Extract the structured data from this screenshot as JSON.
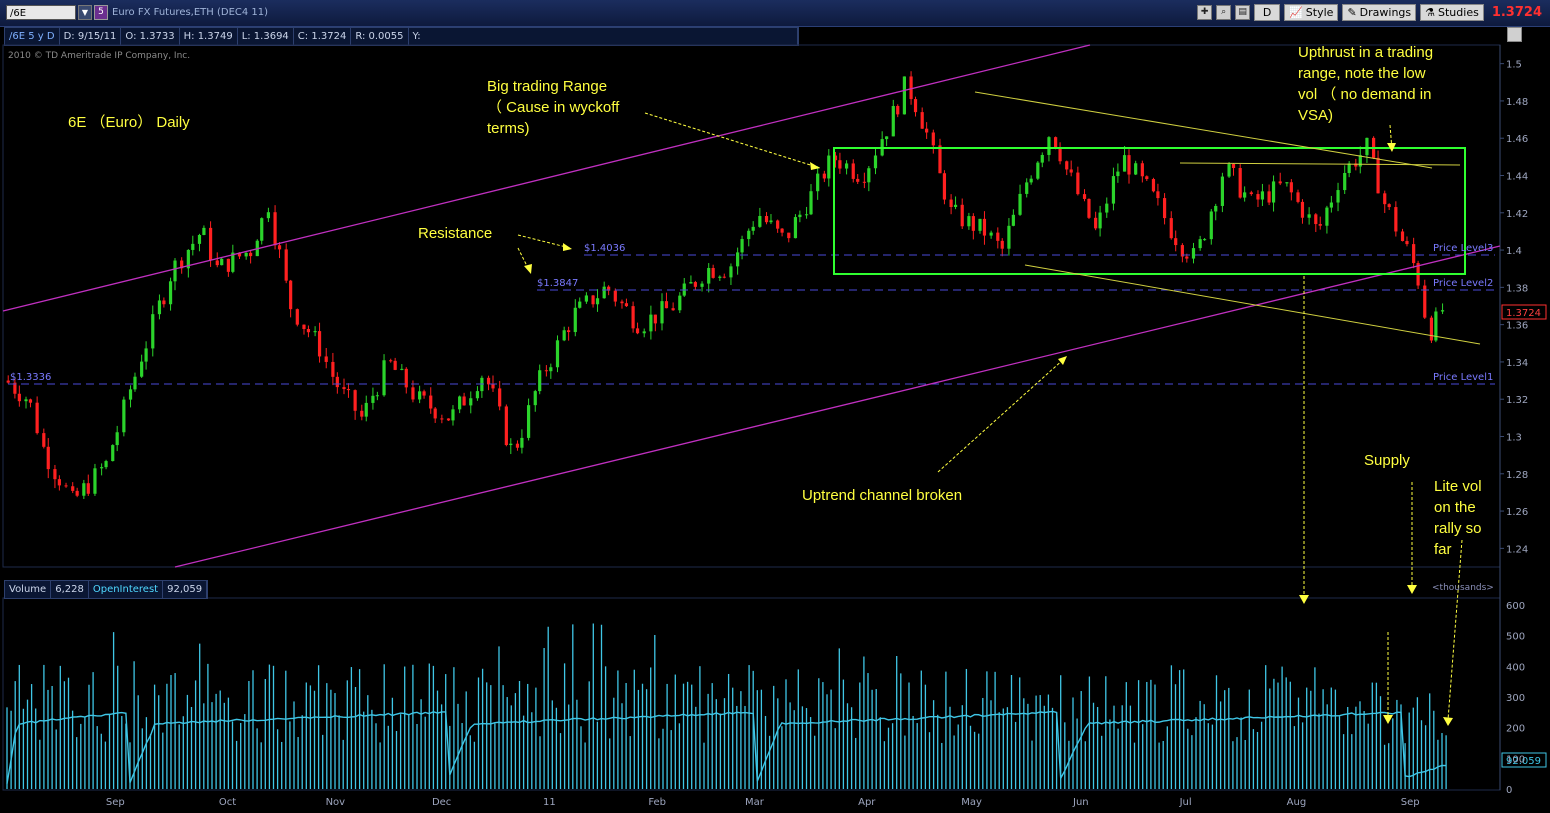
{
  "toolbar": {
    "symbol": "/6E",
    "count_badge": "5",
    "title": "Euro FX Futures,ETH (DEC4 11)",
    "d_label": "D",
    "style_label": "Style",
    "drawings_label": "Drawings",
    "studies_label": "Studies",
    "last_price": "1.3724"
  },
  "info": {
    "symbol_tf": "/6E 5 y D",
    "date": "D: 9/15/11",
    "open": "O: 1.3733",
    "high": "H: 1.3749",
    "low": "L: 1.3694",
    "close": "C: 1.3724",
    "range": "R: 0.0055",
    "y": "Y:"
  },
  "copyright": "2010 © TD Ameritrade IP Company, Inc.",
  "volume_header": {
    "volume_label": "Volume",
    "volume_value": "6,228",
    "oi_label": "OpenInterest",
    "oi_value": "92,059",
    "units": "<thousands>"
  },
  "annotations": {
    "title": "6E （Euro） Daily",
    "range_1": "Big trading Range",
    "range_2": "（ Cause in wyckoff",
    "range_3": "terms)",
    "upthrust_1": "Upthrust in a trading",
    "upthrust_2": "range, note the low",
    "upthrust_3": "vol （ no demand in",
    "upthrust_4": "VSA)",
    "resistance": "Resistance",
    "channel": "Uptrend channel broken",
    "supply": "Supply",
    "litevol_1": "Lite vol",
    "litevol_2": "on the",
    "litevol_3": "rally so",
    "litevol_4": "far"
  },
  "price_labels": {
    "lvl_1_4036": "$1.4036",
    "lvl_1_3847": "$1.3847",
    "lvl_1_3336": "$1.3336",
    "pl3": "Price Level3",
    "pl2": "Price Level2",
    "pl1": "Price Level1",
    "last_box": "1.3724",
    "oi_box": "92.059"
  },
  "colors": {
    "up": "#2bd42b",
    "down": "#ff2020",
    "channel": "#c030c0",
    "range_box": "#30ff30",
    "trend": "#d0d040",
    "dashed": "#4a4ad8",
    "volume": "#3fc6e6",
    "annotation": "#ffff40"
  },
  "chart_data": [
    {
      "type": "candlestick",
      "title": "",
      "xlabel": "",
      "ylabel": "",
      "ylim": [
        1.23,
        1.51
      ],
      "y_ticks": [
        "1.5",
        "1.48",
        "1.46",
        "1.44",
        "1.42",
        "1.4",
        "1.38",
        "1.36",
        "1.34",
        "1.32",
        "1.3",
        "1.28",
        "1.26",
        "1.24"
      ],
      "x_ticks": [
        "Sep",
        "Oct",
        "Nov",
        "Dec",
        "11",
        "Feb",
        "Mar",
        "Apr",
        "May",
        "Jun",
        "Jul",
        "Aug",
        "Sep"
      ],
      "key_prices": {
        "start": 1.33,
        "sep_low": 1.265,
        "oct_high": 1.41,
        "nov_high": 1.425,
        "dec_low": 1.31,
        "jan_low": 1.29,
        "mar_level": 1.39,
        "apr_high": 1.45,
        "may_high": 1.49,
        "range_top": 1.462,
        "range_bottom": 1.395,
        "upthrust_high": 1.455,
        "sep_low_2011": 1.355,
        "last": 1.3724
      },
      "horizontal_levels": [
        1.4036,
        1.3847,
        1.3336
      ]
    },
    {
      "type": "bar",
      "title": "",
      "ylim": [
        0,
        600
      ],
      "y_ticks": [
        "600",
        "500",
        "400",
        "300",
        "200",
        "100",
        "0"
      ],
      "series": [
        {
          "name": "Volume",
          "value_last": 6228
        },
        {
          "name": "OpenInterest",
          "value_last": 92059
        }
      ]
    }
  ]
}
